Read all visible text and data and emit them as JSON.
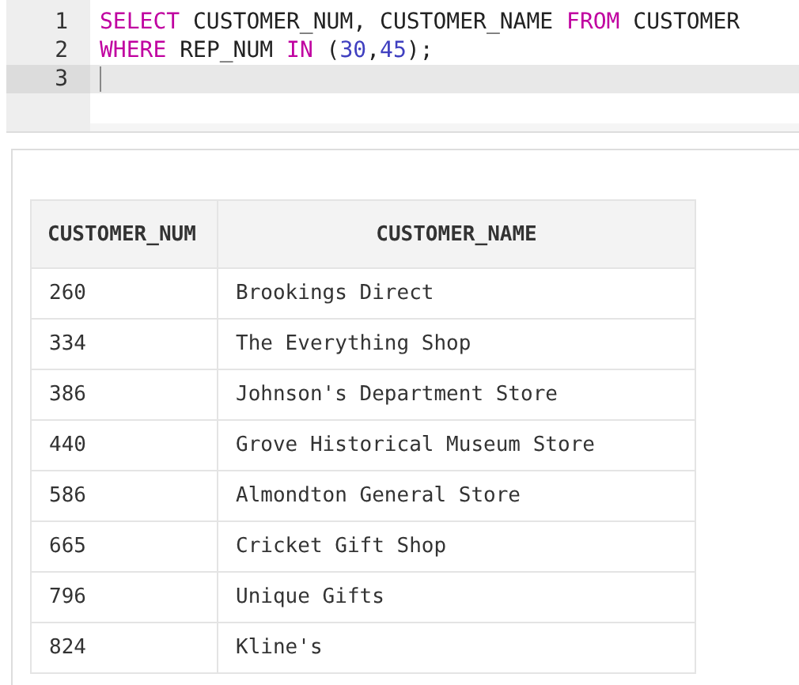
{
  "editor": {
    "lines": [
      {
        "number": "1",
        "active": false,
        "tokens": [
          {
            "kind": "keyword",
            "text": "SELECT"
          },
          {
            "kind": "plain",
            "text": " CUSTOMER_NUM, CUSTOMER_NAME "
          },
          {
            "kind": "keyword",
            "text": "FROM"
          },
          {
            "kind": "plain",
            "text": " CUSTOMER"
          }
        ]
      },
      {
        "number": "2",
        "active": false,
        "tokens": [
          {
            "kind": "keyword",
            "text": "WHERE"
          },
          {
            "kind": "plain",
            "text": " REP_NUM "
          },
          {
            "kind": "keyword",
            "text": "IN"
          },
          {
            "kind": "plain",
            "text": " ("
          },
          {
            "kind": "number",
            "text": "30"
          },
          {
            "kind": "plain",
            "text": ","
          },
          {
            "kind": "number",
            "text": "45"
          },
          {
            "kind": "plain",
            "text": ");"
          }
        ]
      },
      {
        "number": "3",
        "active": true
      }
    ]
  },
  "table": {
    "columns": [
      "CUSTOMER_NUM",
      "CUSTOMER_NAME"
    ],
    "rows": [
      [
        "260",
        "Brookings Direct"
      ],
      [
        "334",
        "The Everything Shop"
      ],
      [
        "386",
        "Johnson's Department Store"
      ],
      [
        "440",
        "Grove Historical Museum Store"
      ],
      [
        "586",
        "Almondton General Store"
      ],
      [
        "665",
        "Cricket Gift Shop"
      ],
      [
        "796",
        "Unique Gifts"
      ],
      [
        "824",
        "Kline's"
      ]
    ]
  }
}
